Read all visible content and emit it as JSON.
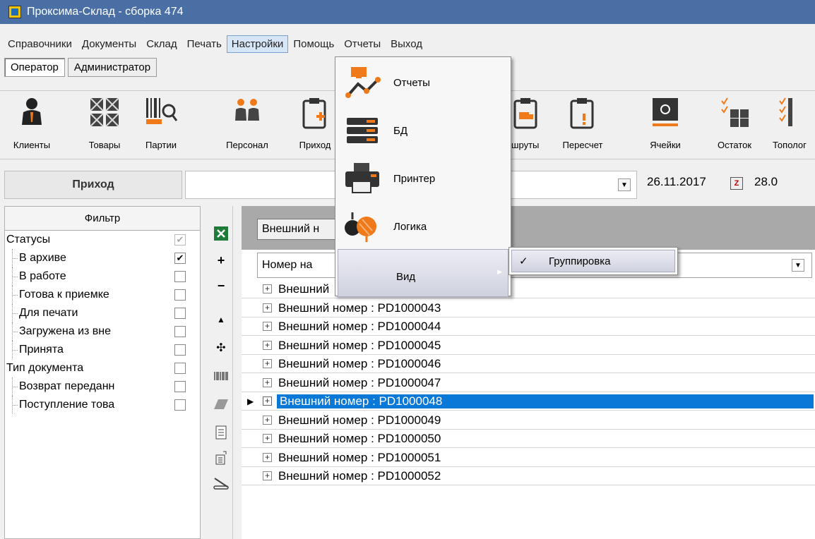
{
  "window": {
    "title": "Проксима-Склад - сборка 474"
  },
  "menubar": {
    "items": [
      "Справочники",
      "Документы",
      "Склад",
      "Печать",
      "Настройки",
      "Помощь",
      "Отчеты",
      "Выход"
    ]
  },
  "modes": {
    "operator": "Оператор",
    "admin": "Администратор"
  },
  "toolbar": {
    "items": [
      "Клиенты",
      "Товары",
      "Партии",
      "Персонал",
      "Приход",
      "Маршруты",
      "Пересчет",
      "Ячейки",
      "Остаток",
      "Тополог"
    ]
  },
  "docbar": {
    "label": "Приход",
    "date_from": "26.11.2017",
    "date_to": "28.0"
  },
  "filter": {
    "title": "Фильтр",
    "rows": [
      {
        "label": "Статусы",
        "level": 0,
        "checked": true,
        "grey": true
      },
      {
        "label": "В архиве",
        "level": 1,
        "checked": true,
        "grey": false
      },
      {
        "label": "В работе",
        "level": 1,
        "checked": false,
        "grey": false
      },
      {
        "label": "Готова к приемке",
        "level": 1,
        "checked": false,
        "grey": false
      },
      {
        "label": "Для печати",
        "level": 1,
        "checked": false,
        "grey": false
      },
      {
        "label": "Загружена из вне",
        "level": 1,
        "checked": false,
        "grey": false
      },
      {
        "label": "Принята",
        "level": 1,
        "checked": false,
        "grey": false
      },
      {
        "label": "Тип документа",
        "level": 0,
        "checked": false,
        "grey": false
      },
      {
        "label": "Возврат переданн",
        "level": 1,
        "checked": false,
        "grey": false
      },
      {
        "label": "Поступление това",
        "level": 1,
        "checked": false,
        "grey": false
      }
    ]
  },
  "grid": {
    "group_box": "Внешний н",
    "column_header": "Номер на",
    "rows": [
      "Внешний",
      "Внешний номер : PD1000043",
      "Внешний номер : PD1000044",
      "Внешний номер : PD1000045",
      "Внешний номер : PD1000046",
      "Внешний номер : PD1000047",
      "Внешний номер : PD1000048",
      "Внешний номер : PD1000049",
      "Внешний номер : PD1000050",
      "Внешний номер : PD1000051",
      "Внешний номер : PD1000052"
    ],
    "selected_row": 6
  },
  "settings_menu": {
    "items": [
      "Отчеты",
      "БД",
      "Принтер",
      "Логика",
      "Вид"
    ]
  },
  "view_submenu": {
    "check": "✓",
    "item": "Группировка"
  },
  "colors": {
    "accent_orange": "#f07a1a",
    "selection_blue": "#0a78d7",
    "title_blue": "#4a6fa5"
  }
}
